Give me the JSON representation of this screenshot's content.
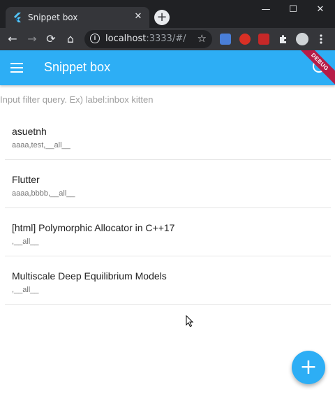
{
  "browser": {
    "tab_title": "Snippet box",
    "tab_close": "✕",
    "new_tab": "+",
    "window_controls": {
      "minimize": "—",
      "maximize": "☐",
      "close": "✕"
    },
    "back": "←",
    "forward": "→",
    "reload": "⟳",
    "home": "⌂",
    "url_host": "localhost",
    "url_rest": ":3333/#/",
    "info_glyph": "i",
    "star": "☆"
  },
  "app": {
    "title": "Snippet box",
    "debug_label": "DEBUG",
    "accent_color": "#2daef5",
    "filter_placeholder": "Input filter query. Ex) label:inbox kitten",
    "fab_label": "+"
  },
  "snippets": [
    {
      "title": "asuetnh",
      "labels": "aaaa,test,__all__"
    },
    {
      "title": "Flutter",
      "labels": "aaaa,bbbb,__all__"
    },
    {
      "title": "[html] Polymorphic Allocator in C++17",
      "labels": ",__all__"
    },
    {
      "title": "Multiscale Deep Equilibrium Models",
      "labels": ",__all__"
    }
  ]
}
